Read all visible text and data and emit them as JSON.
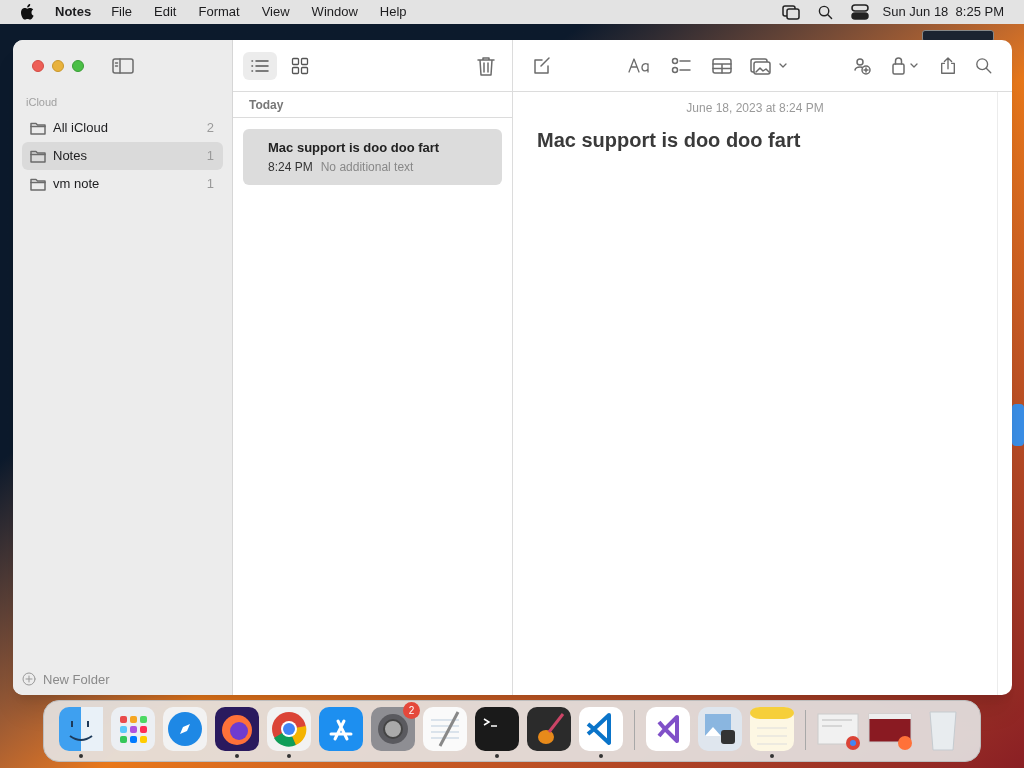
{
  "menu_bar": {
    "app_name": "Notes",
    "menus": [
      "File",
      "Edit",
      "Format",
      "View",
      "Window",
      "Help"
    ],
    "clock": "Sun Jun 18  8:25 PM"
  },
  "sidebar": {
    "section": "iCloud",
    "folders": [
      {
        "name": "All iCloud",
        "count": "2",
        "selected": false
      },
      {
        "name": "Notes",
        "count": "1",
        "selected": true
      },
      {
        "name": "vm note",
        "count": "1",
        "selected": false
      }
    ],
    "new_folder": "New Folder"
  },
  "note_list": {
    "view_modes": [
      {
        "kind": "list",
        "selected": true
      },
      {
        "kind": "gallery",
        "selected": false
      }
    ],
    "group": "Today",
    "notes": [
      {
        "title": "Mac support is doo doo fart",
        "time": "8:24 PM",
        "preview": "No additional text",
        "selected": true
      }
    ]
  },
  "editor": {
    "date": "June 18, 2023 at 8:24 PM",
    "title": "Mac support is doo doo fart"
  },
  "dock": {
    "items": [
      {
        "kind": "finder",
        "running": true
      },
      {
        "kind": "launchpad",
        "running": false
      },
      {
        "kind": "safari",
        "running": false
      },
      {
        "kind": "firefox",
        "running": true
      },
      {
        "kind": "chrome",
        "running": true
      },
      {
        "kind": "appstore",
        "running": false
      },
      {
        "kind": "settings",
        "running": false,
        "badge": "2"
      },
      {
        "kind": "textedit",
        "running": false
      },
      {
        "kind": "terminal",
        "running": true
      },
      {
        "kind": "garageband",
        "running": false
      },
      {
        "kind": "vscode",
        "running": true
      },
      {
        "kind": "divider"
      },
      {
        "kind": "visualstudio",
        "running": false
      },
      {
        "kind": "preview",
        "running": false
      },
      {
        "kind": "notes",
        "running": true
      },
      {
        "kind": "divider"
      },
      {
        "kind": "window_chrome",
        "running": false
      },
      {
        "kind": "window_firefox",
        "running": false
      },
      {
        "kind": "trash",
        "running": false
      }
    ]
  }
}
